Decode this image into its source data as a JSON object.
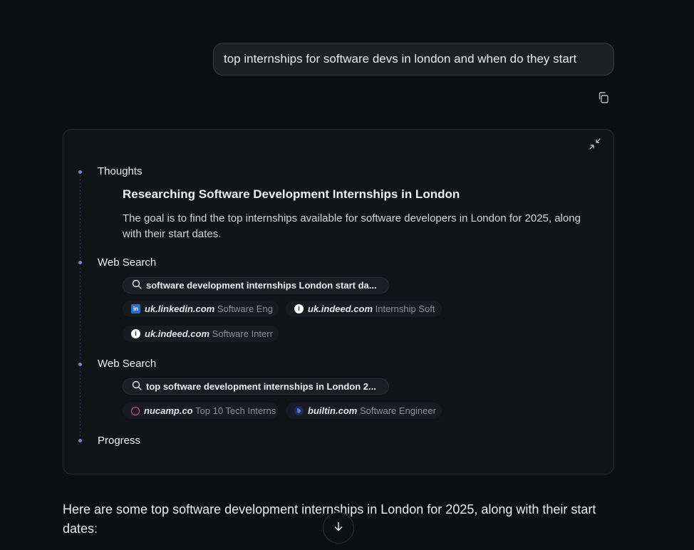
{
  "user_message": "top internships for software devs in london and when do they start",
  "icons": {
    "copy": "copy-icon",
    "collapse": "collapse-icon",
    "search": "search-icon",
    "scroll_down": "arrow-down-icon"
  },
  "colors": {
    "background": "#0d0e11",
    "panel": "#121317",
    "timeline_dot": "#6f86d9",
    "user_bubble": "#1f2024"
  },
  "thinking": {
    "steps": [
      {
        "label": "Thoughts",
        "title": "Researching Software Development Internships in London",
        "body": "The goal is to find the top internships available for software developers in London for 2025, along with their start dates."
      },
      {
        "label": "Web Search",
        "query": "software development internships London start da...",
        "sources": [
          {
            "icon": "linkedin-icon",
            "domain": "uk.linkedin.com",
            "title": "Software Eng"
          },
          {
            "icon": "indeed-icon",
            "domain": "uk.indeed.com",
            "title": "Internship Soft"
          },
          {
            "icon": "indeed-icon",
            "domain": "uk.indeed.com",
            "title": "Software Interr"
          }
        ]
      },
      {
        "label": "Web Search",
        "query": "top software development internships in London 2...",
        "sources": [
          {
            "icon": "nucamp-icon",
            "domain": "nucamp.co",
            "title": "Top 10 Tech Interns"
          },
          {
            "icon": "builtin-icon",
            "domain": "builtin.com",
            "title": "Software Engineer"
          }
        ]
      },
      {
        "label": "Progress"
      }
    ]
  },
  "answer_intro": "Here are some top software development internships in London for 2025, along with their start dates:"
}
